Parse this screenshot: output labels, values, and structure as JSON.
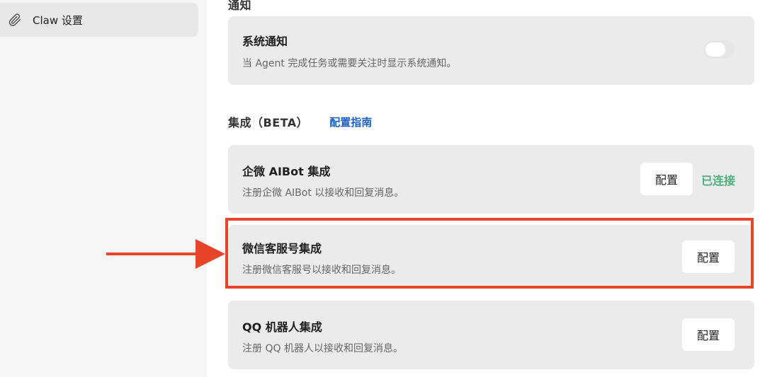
{
  "sidebar": {
    "items": [
      {
        "label": "Claw 设置",
        "icon": "paperclip-icon"
      }
    ]
  },
  "notifications": {
    "section_title": "通知",
    "system": {
      "title": "系统通知",
      "description": "当 Agent 完成任务或需要关注时显示系统通知。",
      "toggle_on": false
    }
  },
  "integrations": {
    "section_title": "集成（BETA）",
    "guide_link": "配置指南",
    "items": [
      {
        "title": "企微 AIBot 集成",
        "description": "注册企微 AIBot 以接收和回复消息。",
        "button": "配置",
        "status": "已连接"
      },
      {
        "title": "微信客服号集成",
        "description": "注册微信客服号以接收和回复消息。",
        "button": "配置"
      },
      {
        "title": "QQ 机器人集成",
        "description": "注册 QQ 机器人以接收和回复消息。",
        "button": "配置"
      }
    ]
  },
  "colors": {
    "highlight": "#e8442a",
    "link": "#1d5fbf",
    "connected": "#4caf7d",
    "card_bg": "#ebebeb"
  }
}
